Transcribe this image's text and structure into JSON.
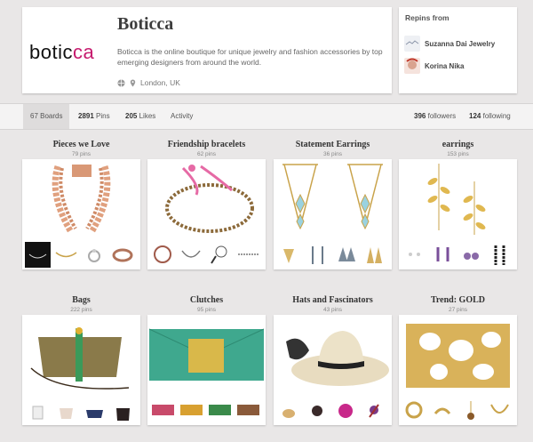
{
  "profile": {
    "logo_prefix": "botic",
    "logo_accent": "ca",
    "name": "Boticca",
    "bio": "Boticca is the online boutique for unique jewelry and fashion accessories by top emerging designers from around the world.",
    "location": "London, UK"
  },
  "repins": {
    "title": "Repins from",
    "users": [
      {
        "name": "Suzanna Dai Jewelry"
      },
      {
        "name": "Korina Nika"
      }
    ]
  },
  "stats": {
    "boards": "67 Boards",
    "pins_count": "2891",
    "pins_label": "Pins",
    "likes_count": "205",
    "likes_label": "Likes",
    "activity": "Activity",
    "followers_count": "396",
    "followers_label": "followers",
    "following_count": "124",
    "following_label": "following"
  },
  "boards": [
    {
      "title": "Pieces we Love",
      "count": "79 pins"
    },
    {
      "title": "Friendship bracelets",
      "count": "62 pins"
    },
    {
      "title": "Statement Earrings",
      "count": "36 pins"
    },
    {
      "title": "earrings",
      "count": "153 pins"
    },
    {
      "title": "Bags",
      "count": "222 pins"
    },
    {
      "title": "Clutches",
      "count": "95 pins"
    },
    {
      "title": "Hats and Fascinators",
      "count": "43 pins"
    },
    {
      "title": "Trend: GOLD",
      "count": "27 pins"
    }
  ],
  "colors": {
    "brand_accent": "#c61b6e",
    "background": "#e9e7e7"
  }
}
